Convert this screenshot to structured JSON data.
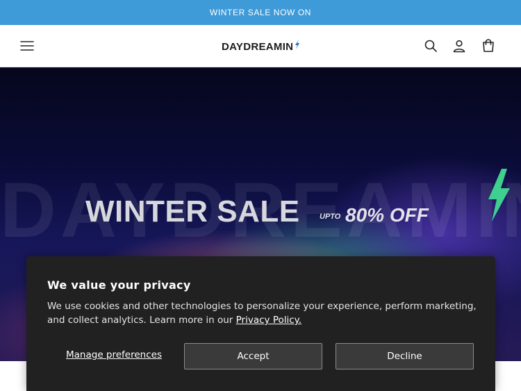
{
  "announcement": {
    "text": "WINTER SALE NOW ON"
  },
  "header": {
    "logo_text": "DAYDREAMIN",
    "icons": [
      "menu-icon",
      "search-icon",
      "account-icon",
      "cart-icon"
    ]
  },
  "hero": {
    "background_word": "DAYDREAMIN",
    "title": "WINTER SALE",
    "upto": "UPTO",
    "discount": "80% OFF",
    "bolt_color": "#3fcf8e"
  },
  "cookie_banner": {
    "title": "We value your privacy",
    "text": "We use cookies and other technologies to personalize your experience, perform marketing, and collect analytics. Learn more in our",
    "link_text": "Privacy Policy.",
    "manage_label": "Manage preferences",
    "accept_label": "Accept",
    "decline_label": "Decline"
  },
  "colors": {
    "announcement_bg": "#3f9ad8",
    "banner_bg": "#212121"
  }
}
